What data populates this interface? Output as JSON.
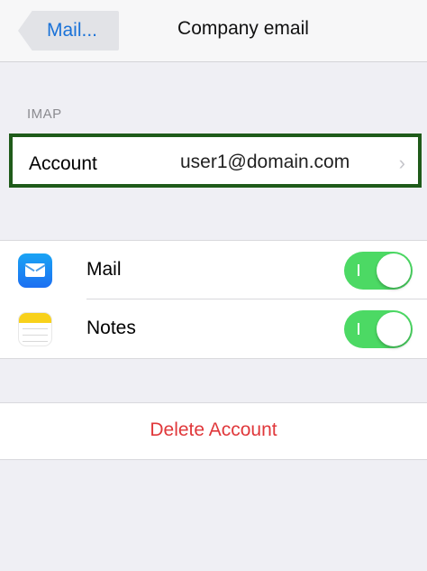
{
  "navbar": {
    "back_label": "Mail...",
    "title": "Company email"
  },
  "imap_section": {
    "header": "IMAP",
    "account_label": "Account",
    "account_value": "user1@domain.com",
    "chevron": "›"
  },
  "toggles": [
    {
      "label": "Mail",
      "icon": "mail-icon",
      "on": true,
      "accent": "#4cd964"
    },
    {
      "label": "Notes",
      "icon": "notes-icon",
      "on": true,
      "accent": "#4cd964"
    }
  ],
  "delete": {
    "label": "Delete Account",
    "color": "#e0383b"
  }
}
